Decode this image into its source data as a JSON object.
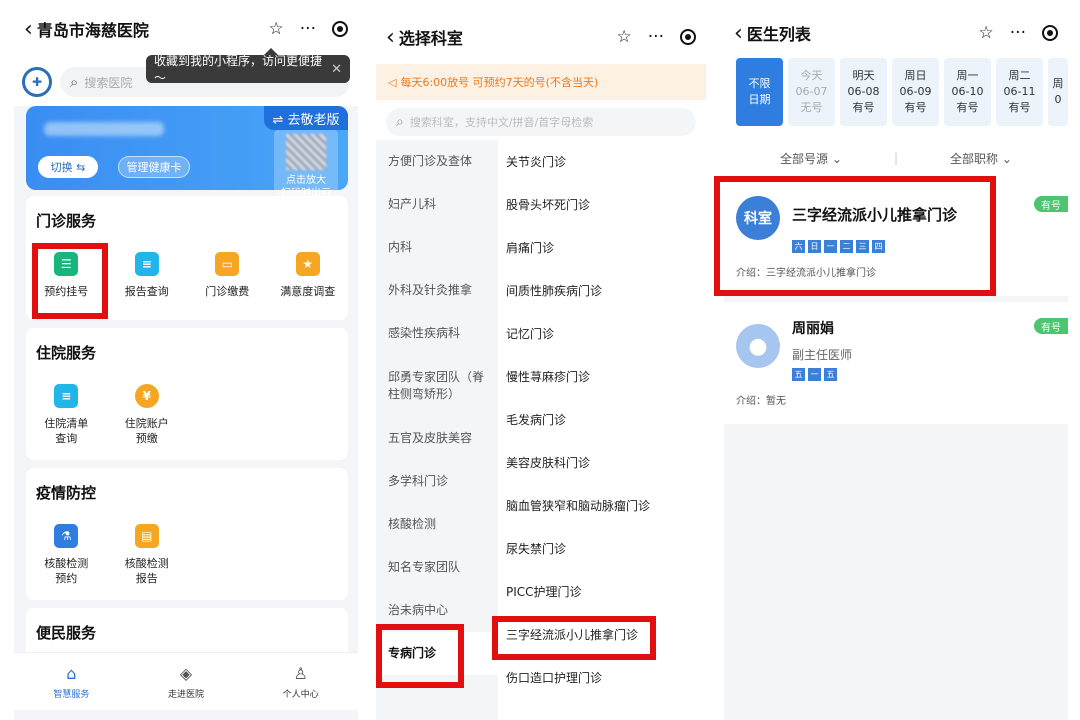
{
  "panel1": {
    "title": "青岛市海慈医院",
    "tooltip": "收藏到我的小程序，访问更便捷～",
    "search_placeholder": "搜索医院",
    "old_version_button": "⇌ 去敬老版",
    "switch_label": "切换",
    "manage_card_label": "管理健康卡",
    "qr_hint": [
      "点击放大",
      "扫码时出示"
    ],
    "sections": [
      {
        "title": "门诊服务",
        "items": [
          {
            "label": "预约挂号",
            "icon": "calendar-icon",
            "color": "#18b67a"
          },
          {
            "label": "报告查询",
            "icon": "report-icon",
            "color": "#22b6e8"
          },
          {
            "label": "门诊缴费",
            "icon": "wallet-icon",
            "color": "#f5a623"
          },
          {
            "label": "满意度调查",
            "icon": "star-clipboard-icon",
            "color": "#f5a623"
          }
        ]
      },
      {
        "title": "住院服务",
        "items": [
          {
            "label": "住院清单\n查询",
            "icon": "list-icon",
            "color": "#22b6e8"
          },
          {
            "label": "住院账户\n预缴",
            "icon": "money-bag-icon",
            "color": "#f5a623"
          }
        ]
      },
      {
        "title": "疫情防控",
        "items": [
          {
            "label": "核酸检测\n预约",
            "icon": "flask-icon",
            "color": "#2f7de1"
          },
          {
            "label": "核酸检测\n报告",
            "icon": "test-report-icon",
            "color": "#f5a623"
          }
        ]
      },
      {
        "title": "便民服务",
        "items": []
      }
    ],
    "tabs": [
      {
        "label": "智慧服务",
        "icon": "home-icon"
      },
      {
        "label": "走进医院",
        "icon": "hospital-icon"
      },
      {
        "label": "个人中心",
        "icon": "user-icon"
      }
    ]
  },
  "panel2": {
    "title": "选择科室",
    "notice": "每天6:00放号 可预约7天的号(不含当天)",
    "search_placeholder": "搜索科室，支持中文/拼音/首字母检索",
    "left_depts": [
      "方便门诊及查体",
      "妇产儿科",
      "内科",
      "外科及针灸推拿",
      "感染性疾病科",
      "邱勇专家团队（脊柱侧弯矫形）",
      "五官及皮肤美容",
      "多学科门诊",
      "核酸检测",
      "知名专家团队",
      "治未病中心",
      "专病门诊"
    ],
    "selected_left": "专病门诊",
    "right_clinics": [
      "关节炎门诊",
      "股骨头坏死门诊",
      "肩痛门诊",
      "间质性肺疾病门诊",
      "记忆门诊",
      "慢性荨麻疹门诊",
      "毛发病门诊",
      "美容皮肤科门诊",
      "脑血管狭窄和脑动脉瘤门诊",
      "尿失禁门诊",
      "PICC护理门诊",
      "三字经流派小儿推拿门诊",
      "伤口造口护理门诊"
    ]
  },
  "panel3": {
    "title": "医生列表",
    "dates": [
      {
        "line1": "不限",
        "line2": "日期",
        "line3": ""
      },
      {
        "line1": "今天",
        "line2": "06-07",
        "line3": "无号"
      },
      {
        "line1": "明天",
        "line2": "06-08",
        "line3": "有号"
      },
      {
        "line1": "周日",
        "line2": "06-09",
        "line3": "有号"
      },
      {
        "line1": "周一",
        "line2": "06-10",
        "line3": "有号"
      },
      {
        "line1": "周二",
        "line2": "06-11",
        "line3": "有号"
      },
      {
        "line1": "周",
        "line2": "0",
        "line3": ""
      }
    ],
    "filter_source": "全部号源 ⌄",
    "filter_title": "全部职称 ⌄",
    "doctors": [
      {
        "avatar_text": "科室",
        "name": "三字经流派小儿推拿门诊",
        "title": "",
        "days": [
          "六",
          "日",
          "一",
          "二",
          "三",
          "四"
        ],
        "intro": "介绍：三字经流派小儿推拿门诊",
        "badge": "有号"
      },
      {
        "avatar_text": "",
        "name": "周丽娟",
        "title": "副主任医师",
        "days": [
          "五",
          "一",
          "五"
        ],
        "intro": "介绍：暂无",
        "badge": "有号"
      }
    ]
  },
  "colors": {
    "accent": "#2f7de1",
    "highlight": "#e10f0f",
    "available": "#4cc470",
    "notice": "#e87a1f"
  }
}
